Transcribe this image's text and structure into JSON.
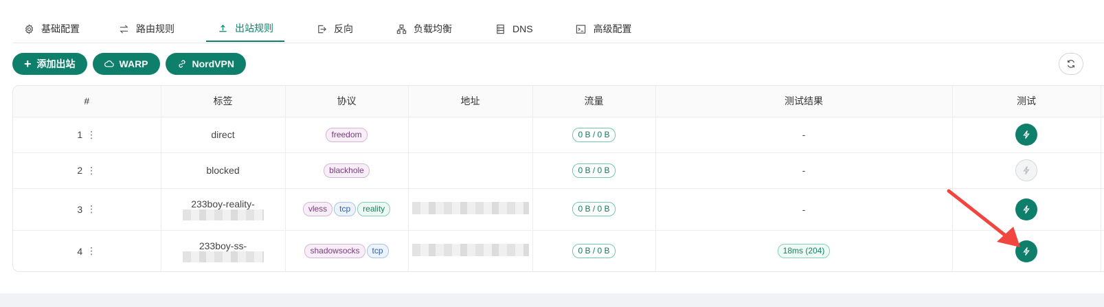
{
  "tabs": [
    {
      "label": "基础配置",
      "icon": "gear-icon"
    },
    {
      "label": "路由规则",
      "icon": "swap-icon"
    },
    {
      "label": "出站规则",
      "icon": "upload-icon",
      "active": true
    },
    {
      "label": "反向",
      "icon": "login-icon"
    },
    {
      "label": "负载均衡",
      "icon": "cluster-icon"
    },
    {
      "label": "DNS",
      "icon": "database-icon"
    },
    {
      "label": "高级配置",
      "icon": "terminal-icon"
    }
  ],
  "toolbar": {
    "add_outbound": "添加出站",
    "warp": "WARP",
    "nordvpn": "NordVPN"
  },
  "table": {
    "headers": {
      "index": "#",
      "tag": "标签",
      "protocol": "协议",
      "address": "地址",
      "traffic": "流量",
      "result": "测试结果",
      "test": "测试"
    },
    "rows": [
      {
        "index": "1",
        "tag": "direct",
        "protocols": [
          "freedom"
        ],
        "traffic": "0 B / 0 B",
        "result": "-"
      },
      {
        "index": "2",
        "tag": "blocked",
        "protocols": [
          "blackhole"
        ],
        "traffic": "0 B / 0 B",
        "result": "-"
      },
      {
        "index": "3",
        "tag": "233boy-reality-",
        "protocols": [
          "vless",
          "tcp",
          "reality"
        ],
        "traffic": "0 B / 0 B",
        "result": "-"
      },
      {
        "index": "4",
        "tag": "233boy-ss-",
        "protocols": [
          "shadowsocks",
          "tcp"
        ],
        "traffic": "0 B / 0 B",
        "result": "18ms (204)"
      }
    ]
  },
  "colors": {
    "accent": "#0d7f6a",
    "arrow": "#f0463f"
  }
}
